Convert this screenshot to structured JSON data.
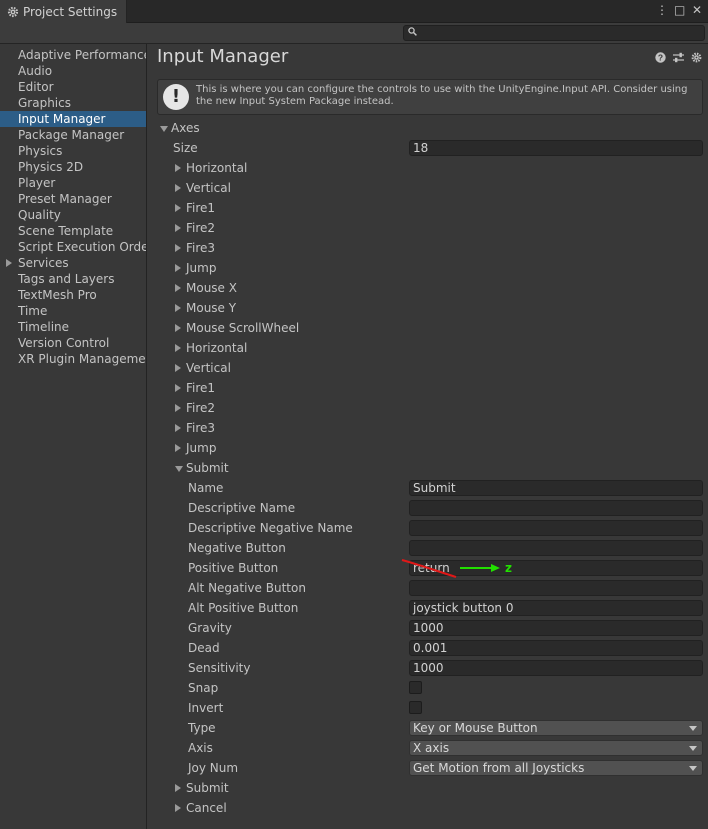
{
  "window": {
    "tab_title": "Project Settings",
    "more_icon": "⋮",
    "maximize_icon": "□",
    "close_icon": "✕"
  },
  "toolbar": {
    "search_placeholder": ""
  },
  "sidebar": {
    "items": [
      {
        "label": "Adaptive Performance"
      },
      {
        "label": "Audio"
      },
      {
        "label": "Editor"
      },
      {
        "label": "Graphics"
      },
      {
        "label": "Input Manager"
      },
      {
        "label": "Package Manager"
      },
      {
        "label": "Physics"
      },
      {
        "label": "Physics 2D"
      },
      {
        "label": "Player"
      },
      {
        "label": "Preset Manager"
      },
      {
        "label": "Quality"
      },
      {
        "label": "Scene Template"
      },
      {
        "label": "Script Execution Order"
      },
      {
        "label": "Services"
      },
      {
        "label": "Tags and Layers"
      },
      {
        "label": "TextMesh Pro"
      },
      {
        "label": "Time"
      },
      {
        "label": "Timeline"
      },
      {
        "label": "Version Control"
      },
      {
        "label": "XR Plugin Management"
      }
    ],
    "selected": "Input Manager"
  },
  "main": {
    "title": "Input Manager",
    "help_text": "This is where you can configure the controls to use with the UnityEngine.Input API. Consider using the new Input System Package instead.",
    "axes_label": "Axes",
    "size_label": "Size",
    "size_value": "18",
    "collapsed_axes": [
      "Horizontal",
      "Vertical",
      "Fire1",
      "Fire2",
      "Fire3",
      "Jump",
      "Mouse X",
      "Mouse Y",
      "Mouse ScrollWheel",
      "Horizontal",
      "Vertical",
      "Fire1",
      "Fire2",
      "Fire3",
      "Jump"
    ],
    "expanded_axis": {
      "label": "Submit",
      "name_label": "Name",
      "name_value": "Submit",
      "descriptive_name_label": "Descriptive Name",
      "descriptive_name_value": "",
      "descriptive_negative_name_label": "Descriptive Negative Name",
      "descriptive_negative_name_value": "",
      "negative_button_label": "Negative Button",
      "negative_button_value": "",
      "positive_button_label": "Positive Button",
      "positive_button_value": "return",
      "alt_negative_button_label": "Alt Negative Button",
      "alt_negative_button_value": "",
      "alt_positive_button_label": "Alt Positive Button",
      "alt_positive_button_value": "joystick button 0",
      "gravity_label": "Gravity",
      "gravity_value": "1000",
      "dead_label": "Dead",
      "dead_value": "0.001",
      "sensitivity_label": "Sensitivity",
      "sensitivity_value": "1000",
      "snap_label": "Snap",
      "snap_checked": false,
      "invert_label": "Invert",
      "invert_checked": false,
      "type_label": "Type",
      "type_value": "Key or Mouse Button",
      "axis_label": "Axis",
      "axis_value": "X axis",
      "joy_num_label": "Joy Num",
      "joy_num_value": "Get Motion from all Joysticks"
    },
    "trailing_axes": [
      "Submit",
      "Cancel"
    ]
  },
  "annotation": {
    "replacement_text": "z",
    "arrow_color": "#22e000",
    "strike_color": "#e01818"
  }
}
